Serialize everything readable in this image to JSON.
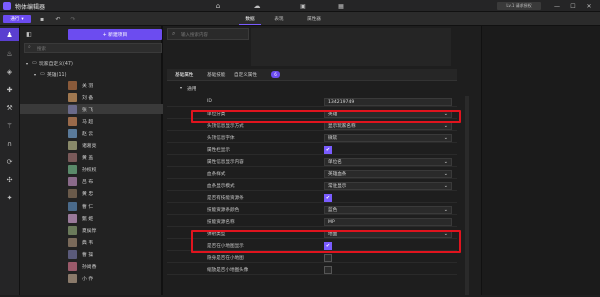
{
  "window": {
    "title": "物体编辑器",
    "minimize_label": "—",
    "maximize_label": "☐",
    "close_label": "✕",
    "user_label": "Lv.1 请求授权"
  },
  "toolbar": {
    "mode_label": "通行",
    "tabs": [
      "数据",
      "表现",
      "属性器"
    ]
  },
  "tree": {
    "new_button_label": "+ 新建项目",
    "search_placeholder": "搜索",
    "root_label": "玩家自定义(47)",
    "folder_label": "英雄(11)",
    "items": [
      {
        "name": "关 羽",
        "color": "#8a5a3a"
      },
      {
        "name": "刘 备",
        "color": "#a07850"
      },
      {
        "name": "张 飞",
        "color": "#6a6a8a"
      },
      {
        "name": "马 超",
        "color": "#9a6a4a"
      },
      {
        "name": "赵 云",
        "color": "#5a7a9a"
      },
      {
        "name": "诸葛亮",
        "color": "#8a8a6a"
      },
      {
        "name": "黄 盖",
        "color": "#7a5a5a"
      },
      {
        "name": "孙权权",
        "color": "#5a8a6a"
      },
      {
        "name": "吕 布",
        "color": "#8a6a8a"
      },
      {
        "name": "黄 忠",
        "color": "#6a5a4a"
      },
      {
        "name": "曹 仁",
        "color": "#4a6a8a"
      },
      {
        "name": "甄 姬",
        "color": "#9a7a9a"
      },
      {
        "name": "夏侯惇",
        "color": "#6a7a5a"
      },
      {
        "name": "典 韦",
        "color": "#7a6a5a"
      },
      {
        "name": "曹 操",
        "color": "#5a5a7a"
      },
      {
        "name": "孙尚香",
        "color": "#9a5a6a"
      },
      {
        "name": "小 乔",
        "color": "#8a7a6a"
      }
    ]
  },
  "props": {
    "search_placeholder": "输入搜索内容",
    "tabs": [
      "基础属性",
      "基础技能",
      "自定义属性"
    ],
    "badge": "6",
    "group_label": "通用",
    "rows": [
      {
        "label": "ID",
        "value": "134219749",
        "type": "text"
      },
      {
        "label": "单位分类",
        "value": "英雄",
        "type": "select"
      },
      {
        "label": "头顶信息显示方式",
        "value": "显示玩家名称",
        "type": "select"
      },
      {
        "label": "头顶信息字体",
        "value": "微软",
        "type": "select"
      },
      {
        "label": "属性栏显示",
        "value": "✔",
        "type": "check"
      },
      {
        "label": "属性信息显示内容",
        "value": "单位名",
        "type": "select"
      },
      {
        "label": "血条样式",
        "value": "英雄血条",
        "type": "select"
      },
      {
        "label": "血条显示模式",
        "value": "常驻显示",
        "type": "select"
      },
      {
        "label": "是否有技能资源条",
        "value": "✔",
        "type": "check"
      },
      {
        "label": "技能资源条颜色",
        "value": "蓝色",
        "type": "select"
      },
      {
        "label": "技能资源名称",
        "value": "MP",
        "type": "text"
      },
      {
        "label": "弹射类型",
        "value": "地面",
        "type": "select"
      },
      {
        "label": "是否在小地图显示",
        "value": "✔",
        "type": "check"
      },
      {
        "label": "隐身是否在小地图",
        "value": "",
        "type": "checkoff"
      },
      {
        "label": "缩放是否小地图头像",
        "value": "",
        "type": "checkoff"
      }
    ]
  }
}
